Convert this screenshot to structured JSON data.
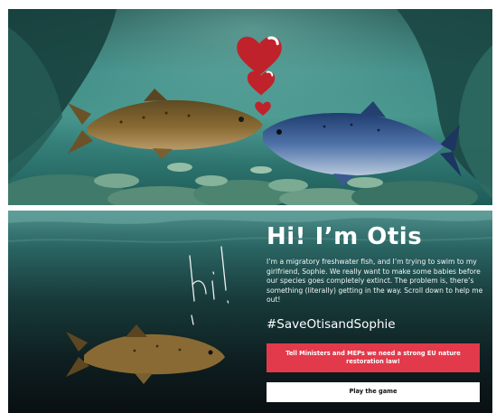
{
  "scene_top": {
    "hearts": [
      "heart-large",
      "heart-medium",
      "heart-small"
    ],
    "fish": [
      "brown-salmon",
      "blue-salmon"
    ]
  },
  "scene_bottom": {
    "handwriting": "hi!",
    "fish": [
      "brown-salmon"
    ]
  },
  "intro": {
    "headline": "Hi! I’m Otis",
    "body": "I’m a migratory freshwater fish, and I’m trying to swim to my girlfriend, Sophie. We really want to make some babies before our species goes completely extinct. The problem is, there’s something (literally) getting in the way. Scroll down to help me out!",
    "hashtag": "#SaveOtisandSophie"
  },
  "actions": {
    "petition_label": "Tell Ministers and MEPs we need a strong EU nature restoration law!",
    "game_label": "Play the game"
  },
  "colors": {
    "accent": "#e23a4b",
    "heart": "#c0222c",
    "text": "#ffffff"
  }
}
